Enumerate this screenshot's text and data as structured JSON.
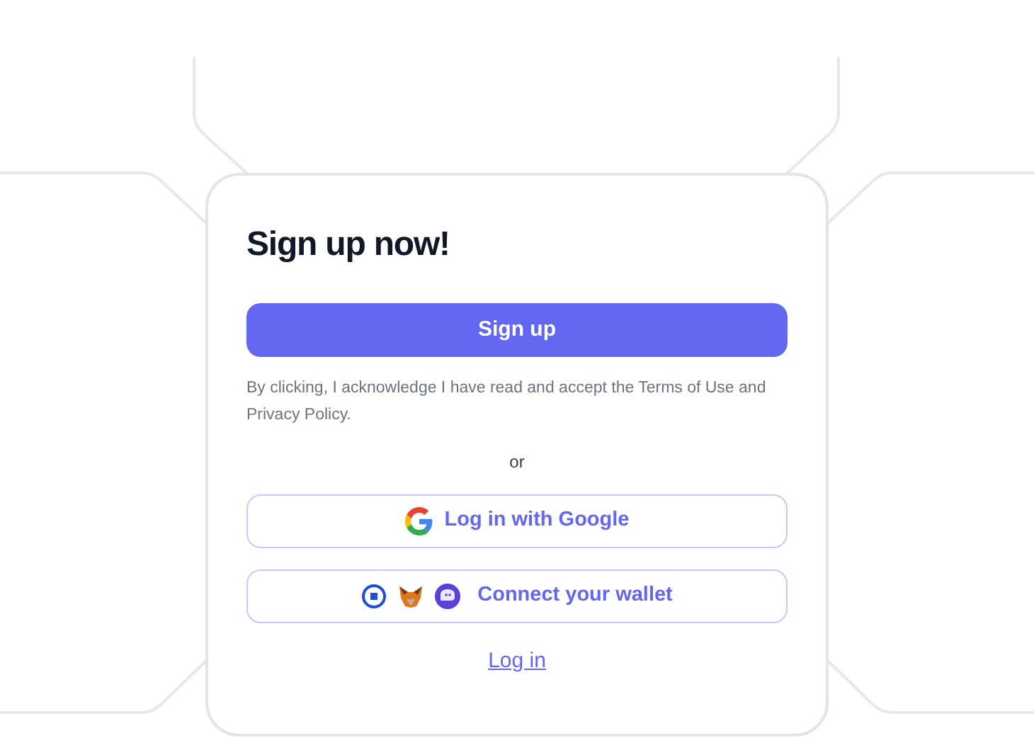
{
  "title": "Sign up now!",
  "signup_button": "Sign up",
  "disclaimer": "By clicking, I acknowledge I have read and accept the Terms of Use and Privacy Policy.",
  "separator": "or",
  "google_button": "Log in with Google",
  "wallet_button": "Connect your wallet",
  "login_link": "Log in"
}
